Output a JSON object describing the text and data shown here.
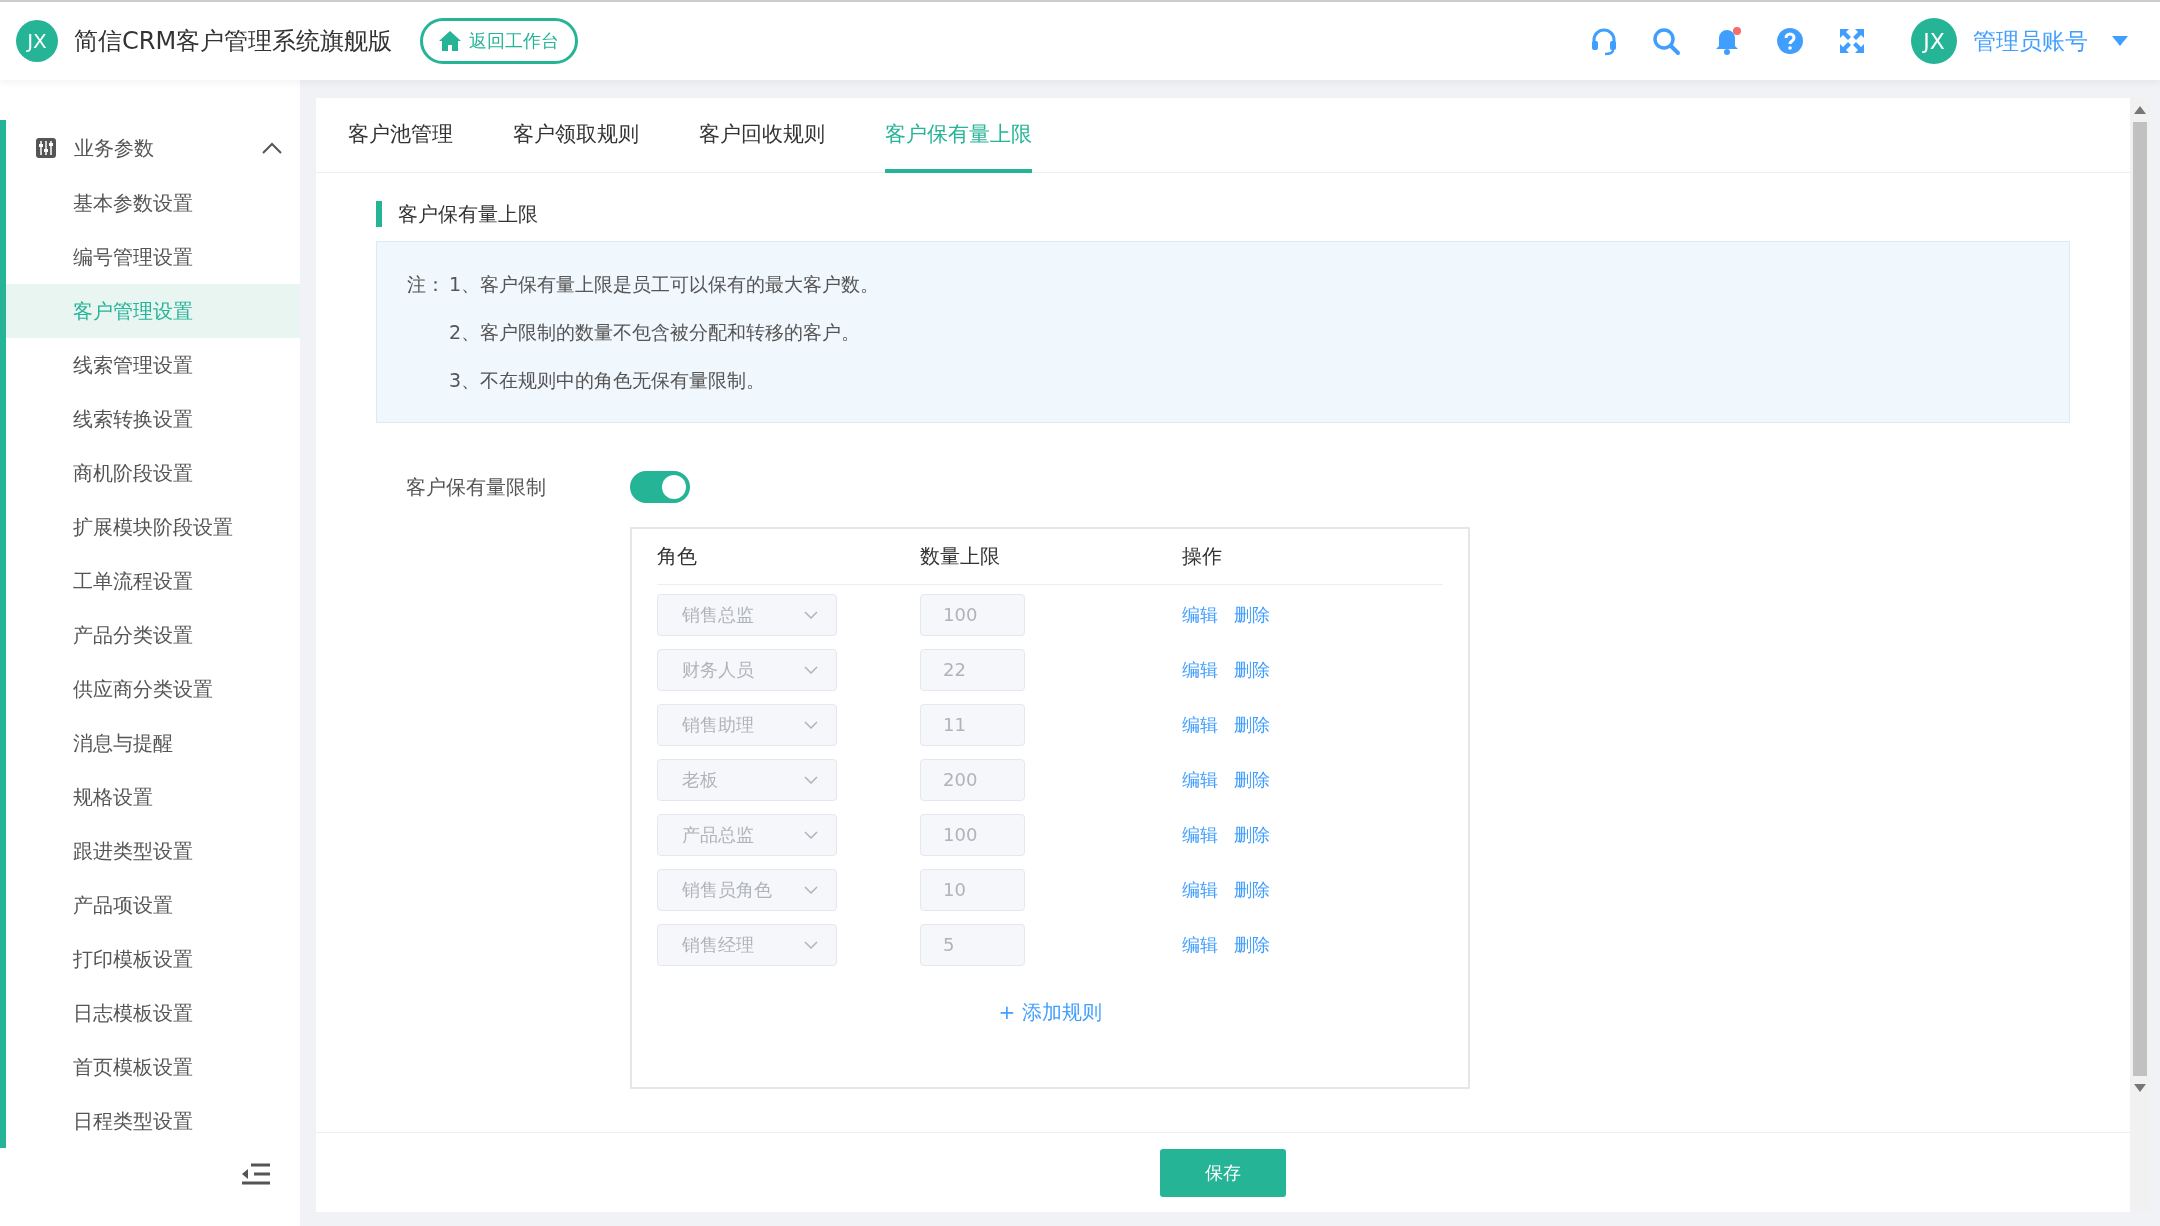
{
  "header": {
    "app_title": "简信CRM客户管理系统旗舰版",
    "logo_text": "JX",
    "back_button": "返回工作台",
    "notifications": {
      "unread": true
    },
    "avatar_text": "JX",
    "user_name": "管理员账号"
  },
  "sidebar": {
    "group": {
      "label": "业务参数",
      "expanded": true
    },
    "items": [
      {
        "label": "基本参数设置",
        "selected": false
      },
      {
        "label": "编号管理设置",
        "selected": false
      },
      {
        "label": "客户管理设置",
        "selected": true
      },
      {
        "label": "线索管理设置",
        "selected": false
      },
      {
        "label": "线索转换设置",
        "selected": false
      },
      {
        "label": "商机阶段设置",
        "selected": false
      },
      {
        "label": "扩展模块阶段设置",
        "selected": false
      },
      {
        "label": "工单流程设置",
        "selected": false
      },
      {
        "label": "产品分类设置",
        "selected": false
      },
      {
        "label": "供应商分类设置",
        "selected": false
      },
      {
        "label": "消息与提醒",
        "selected": false
      },
      {
        "label": "规格设置",
        "selected": false
      },
      {
        "label": "跟进类型设置",
        "selected": false
      },
      {
        "label": "产品项设置",
        "selected": false
      },
      {
        "label": "打印模板设置",
        "selected": false
      },
      {
        "label": "日志模板设置",
        "selected": false
      },
      {
        "label": "首页模板设置",
        "selected": false
      },
      {
        "label": "日程类型设置",
        "selected": false
      }
    ]
  },
  "tabs": [
    {
      "label": "客户池管理",
      "selected": false
    },
    {
      "label": "客户领取规则",
      "selected": false
    },
    {
      "label": "客户回收规则",
      "selected": false
    },
    {
      "label": "客户保有量上限",
      "selected": true
    }
  ],
  "section_title": "客户保有量上限",
  "notes": {
    "label": "注：",
    "lines": [
      "1、客户保有量上限是员工可以保有的最大客户数。",
      "2、客户限制的数量不包含被分配和转移的客户。",
      "3、不在规则中的角色无保有量限制。"
    ]
  },
  "limit_toggle": {
    "label": "客户保有量限制",
    "on": true
  },
  "rules": {
    "columns": [
      "角色",
      "数量上限",
      "操作"
    ],
    "rows": [
      {
        "role": "销售总监",
        "limit": "100",
        "actions": [
          "编辑",
          "删除"
        ]
      },
      {
        "role": "财务人员",
        "limit": "22",
        "actions": [
          "编辑",
          "删除"
        ]
      },
      {
        "role": "销售助理",
        "limit": "11",
        "actions": [
          "编辑",
          "删除"
        ]
      },
      {
        "role": "老板",
        "limit": "200",
        "actions": [
          "编辑",
          "删除"
        ]
      },
      {
        "role": "产品总监",
        "limit": "100",
        "actions": [
          "编辑",
          "删除"
        ]
      },
      {
        "role": "销售员角色",
        "limit": "10",
        "actions": [
          "编辑",
          "删除"
        ]
      },
      {
        "role": "销售经理",
        "limit": "5",
        "actions": [
          "编辑",
          "删除"
        ]
      }
    ],
    "add_button": "+ 添加规则"
  },
  "save_button": "保存"
}
